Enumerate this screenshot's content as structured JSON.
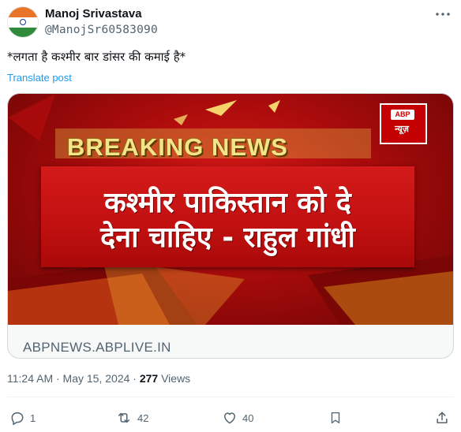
{
  "author": {
    "name": "Manoj Srivastava",
    "handle": "@ManojSr60583090",
    "avatar_icon": "india-flag-icon"
  },
  "post": {
    "text": "*लगता है कश्मीर बार डांसर की कमाई है*",
    "translate_label": "Translate post",
    "card": {
      "image": {
        "breaking_label": "BREAKING NEWS",
        "headline_line1": "कश्मीर पाकिस्तान को दे",
        "headline_line2": "देना चाहिए - राहुल गांधी",
        "logo_text": "ABP",
        "logo_hindi": "न्यूज़"
      },
      "domain": "ABPNEWS.ABPLIVE.IN"
    },
    "time": "11:24 AM · May 15, 2024 ·",
    "views_count": "277",
    "views_label": "Views"
  },
  "actions": {
    "reply_count": "1",
    "repost_count": "42",
    "like_count": "40"
  },
  "colors": {
    "accent": "#1d9bf0",
    "secondary_text": "#536471",
    "news_red": "#c40000"
  }
}
